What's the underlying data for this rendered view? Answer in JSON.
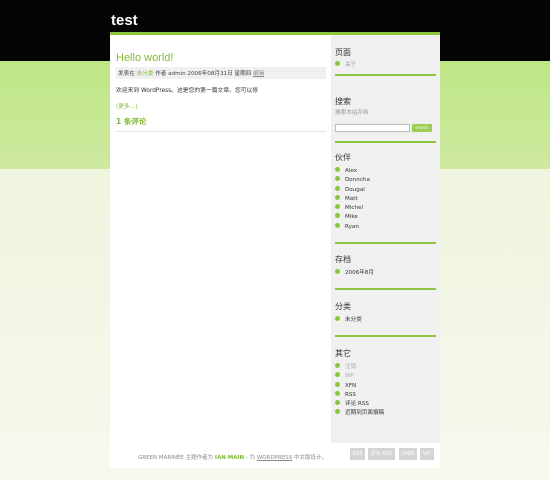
{
  "site": {
    "title": "test"
  },
  "post": {
    "title": "Hello world!",
    "meta_prefix": "发表在",
    "category": "未分类",
    "meta_author": "作者 admin 2006年08月31日 星期四",
    "edit_label": "编辑",
    "body": "欢迎来到 WordPress。这是您的第一篇文章。您可以修",
    "more": "(更多...)",
    "comments": "1 条评论"
  },
  "sidebar": {
    "pages": {
      "title": "页面",
      "items": [
        "关于"
      ]
    },
    "search": {
      "title": "搜索",
      "description": "搜索本站存档",
      "button": "search"
    },
    "blogroll": {
      "title": "伙伴",
      "items": [
        "Alex",
        "Donncha",
        "Dougal",
        "Matt",
        "Michel",
        "Mike",
        "Ryan"
      ]
    },
    "archives": {
      "title": "存档",
      "items": [
        "2006年8月"
      ]
    },
    "categories": {
      "title": "分类",
      "items": [
        "未分类"
      ]
    },
    "meta": {
      "title": "其它",
      "items": [
        "注销",
        "WP",
        "XFN",
        "RSS",
        "评论 RSS",
        "近期到页面撰稿"
      ]
    }
  },
  "footer": {
    "theme": "GREEN MARINÉE 主题作者为",
    "author": "IAN MAIN",
    "sep": " - 为",
    "wp": "WORDPRESS",
    "suffix": "中文版设计。",
    "badges": [
      "RSS",
      "评论 RSS",
      "XMIN",
      "WP"
    ]
  },
  "colors": {
    "accent": "#8cc63f",
    "header": "#050505",
    "band": "#c6e894"
  }
}
